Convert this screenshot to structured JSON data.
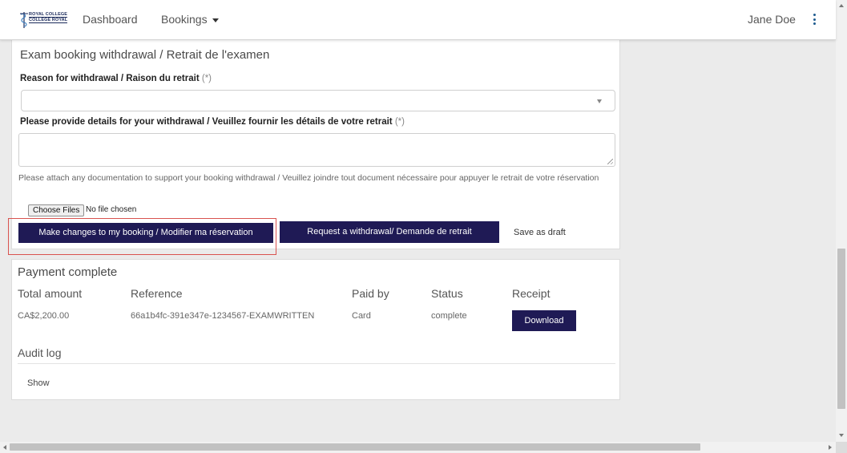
{
  "nav": {
    "logo_line1": "ROYAL COLLEGE",
    "logo_line2": "COLLÈGE ROYAL",
    "dashboard": "Dashboard",
    "bookings": "Bookings",
    "user_name": "Jane Doe"
  },
  "withdrawal": {
    "title": "Exam booking withdrawal / Retrait de l'examen",
    "reason_label": "Reason for withdrawal / Raison du retrait",
    "details_label": "Please provide details for your withdrawal / Veuillez fournir les détails de votre retrait",
    "required_mark": "(*)",
    "reason_value": "",
    "details_value": "",
    "attach_help": "Please attach any documentation to support your booking withdrawal / Veuillez joindre tout document nécessaire pour appuyer le retrait de votre réservation",
    "choose_files": "Choose Files",
    "no_file": "No file chosen",
    "btn_changes": "Make changes to my booking / Modifier ma réservation",
    "btn_withdraw": "Request a withdrawal/ Demande de retrait",
    "btn_draft": "Save as draft"
  },
  "payment": {
    "title": "Payment complete",
    "headers": {
      "total": "Total amount",
      "reference": "Reference",
      "paid_by": "Paid by",
      "status": "Status",
      "receipt": "Receipt"
    },
    "row": {
      "total": "CA$2,200.00",
      "reference": "66a1b4fc-391e347e-1234567-EXAMWRITTEN",
      "paid_by": "Card",
      "status": "complete",
      "download": "Download"
    },
    "audit_title": "Audit log",
    "audit_show": "Show"
  },
  "colors": {
    "primary_button": "#1f1a55",
    "highlight": "#d9534f",
    "background": "#ebebeb"
  }
}
